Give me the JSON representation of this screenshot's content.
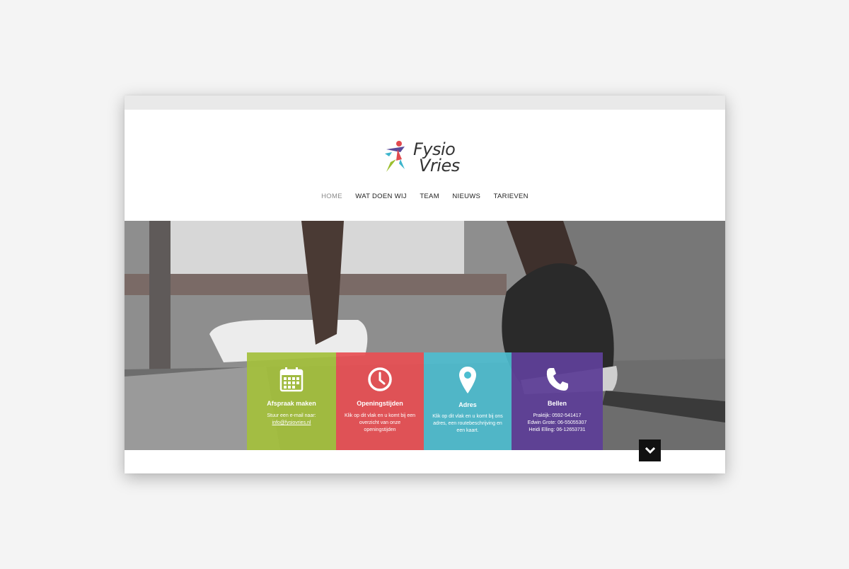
{
  "logo": {
    "line1": "Fysio",
    "line2": "Vries"
  },
  "nav": [
    {
      "label": "HOME",
      "active": true
    },
    {
      "label": "WAT DOEN WIJ",
      "active": false
    },
    {
      "label": "TEAM",
      "active": false
    },
    {
      "label": "NIEUWS",
      "active": false
    },
    {
      "label": "TARIEVEN",
      "active": false
    }
  ],
  "cards": [
    {
      "title": "Afspraak maken",
      "icon": "calendar-icon",
      "color": "#a4bf3c",
      "lines": [
        "Stuur een e-mail naar:",
        "info@fysiovries.nl"
      ]
    },
    {
      "title": "Openingstijden",
      "icon": "clock-icon",
      "color": "#e75054",
      "lines": [
        "Klik op dit vlak en u komt bij een overzicht van onze openingstijden"
      ]
    },
    {
      "title": "Adres",
      "icon": "map-pin-icon",
      "color": "#4dbed0",
      "lines": [
        "Klik op dit vlak en u komt bij ons adres, een routebeschrijving en een kaart."
      ]
    },
    {
      "title": "Bellen",
      "icon": "phone-icon",
      "color": "#5e3f97",
      "lines": [
        "Praktijk: 0592-541417",
        "Edwin Grote: 06-55055307",
        "Heidi Elling: 06-12653731"
      ]
    }
  ],
  "scroll_down_icon": "chevron-down-icon"
}
